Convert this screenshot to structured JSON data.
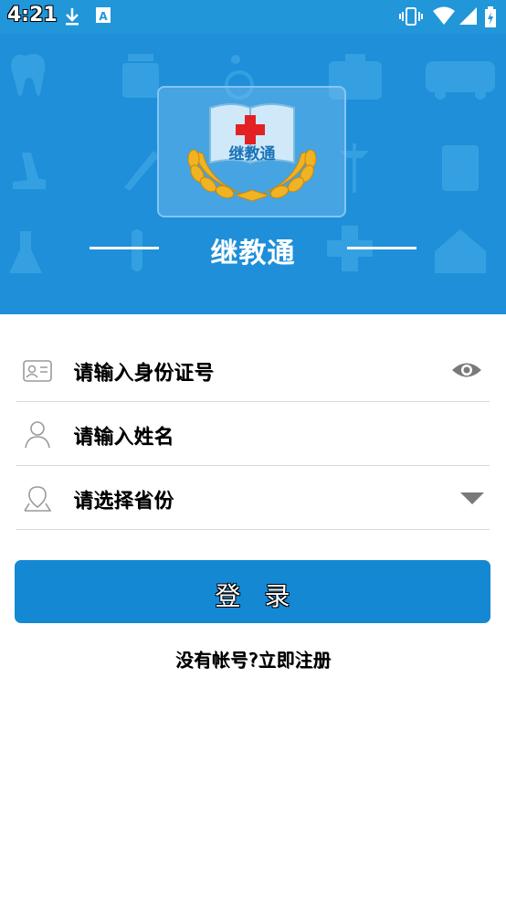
{
  "status_bar": {
    "time": "4:21",
    "left_icons": [
      "download-icon",
      "a-icon"
    ],
    "right_icons": [
      "vibrate-icon",
      "wifi-icon",
      "signal-icon",
      "battery-charging-icon"
    ]
  },
  "banner": {
    "app_title": "继教通",
    "logo_text": "继教通",
    "background_color": "#1e8fd8"
  },
  "form": {
    "id_field": {
      "placeholder": "请输入身份证号",
      "icon": "id-card-icon",
      "trailing_icon": "eye-icon"
    },
    "name_field": {
      "placeholder": "请输入姓名",
      "icon": "person-icon"
    },
    "province_field": {
      "placeholder": "请选择省份",
      "icon": "location-icon",
      "trailing_icon": "caret-down-icon"
    }
  },
  "login_button": {
    "label": "登录",
    "color": "#1588d3"
  },
  "register_link": {
    "label": "没有帐号?立即注册"
  }
}
